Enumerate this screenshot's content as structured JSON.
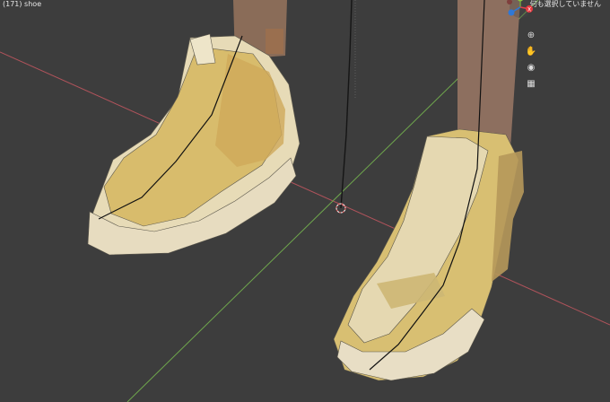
{
  "viewport": {
    "object_info": "(171) shoe",
    "status_message": "何も選択していません"
  },
  "navigation": {
    "gizmo": {
      "axes": [
        {
          "label": "Y",
          "color": "#8cc63f"
        },
        {
          "label": "X",
          "color": "#e8393f"
        },
        {
          "label": "Z",
          "color": "#2f78d6"
        }
      ]
    },
    "tools": [
      {
        "icon": "zoom-icon",
        "glyph": "⊕"
      },
      {
        "icon": "hand-pan-icon",
        "glyph": "✋"
      },
      {
        "icon": "camera-icon",
        "glyph": "📷"
      },
      {
        "icon": "grid-perspective-icon",
        "glyph": "▦"
      }
    ]
  },
  "colors": {
    "background": "#3d3d3d",
    "grid_red": "#b8525a",
    "grid_green": "#6aa84f",
    "shoe_light": "#e9dfbf",
    "shoe_gold": "#d8c077",
    "leg": "#8a6d55"
  }
}
